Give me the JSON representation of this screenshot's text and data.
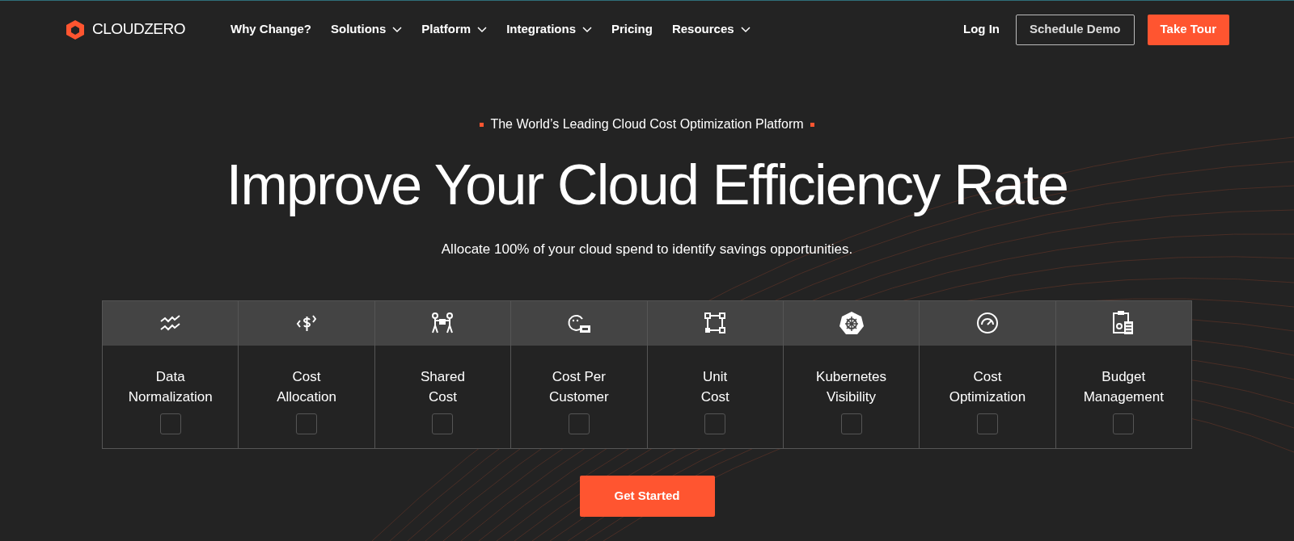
{
  "brand": {
    "name": "CLOUDZERO"
  },
  "nav": [
    {
      "label": "Why Change?",
      "has_menu": false
    },
    {
      "label": "Solutions",
      "has_menu": true
    },
    {
      "label": "Platform",
      "has_menu": true
    },
    {
      "label": "Integrations",
      "has_menu": true
    },
    {
      "label": "Pricing",
      "has_menu": false
    },
    {
      "label": "Resources",
      "has_menu": true
    }
  ],
  "actions": [
    {
      "label": "Log In",
      "kind": "link"
    },
    {
      "label": "Schedule Demo",
      "kind": "outline"
    },
    {
      "label": "Take Tour",
      "kind": "primary"
    }
  ],
  "hero": {
    "eyebrow": "The World’s Leading Cloud Cost Optimization Platform",
    "title": "Improve Your Cloud Efficiency Rate",
    "subtitle": "Allocate 100% of your cloud spend to identify savings opportunities."
  },
  "features": [
    {
      "kind": "normalize",
      "label_lines": [
        "Data",
        "Normalization"
      ],
      "checked": false
    },
    {
      "kind": "dollar",
      "label_lines": [
        "Cost",
        "Allocation"
      ],
      "checked": false
    },
    {
      "kind": "people",
      "label_lines": [
        "Shared",
        "Cost"
      ],
      "checked": false
    },
    {
      "kind": "customer",
      "label_lines": [
        "Cost Per",
        "Customer"
      ],
      "checked": false
    },
    {
      "kind": "nodes",
      "label_lines": [
        "Unit",
        "Cost"
      ],
      "checked": false
    },
    {
      "kind": "helm",
      "label_lines": [
        "Kubernetes",
        "Visibility"
      ],
      "checked": false
    },
    {
      "kind": "gauge",
      "label_lines": [
        "Cost",
        "Optimization"
      ],
      "checked": false
    },
    {
      "kind": "clipboard",
      "label_lines": [
        "Budget",
        "Management"
      ],
      "checked": false
    }
  ],
  "cta": {
    "label": "Get Started"
  }
}
